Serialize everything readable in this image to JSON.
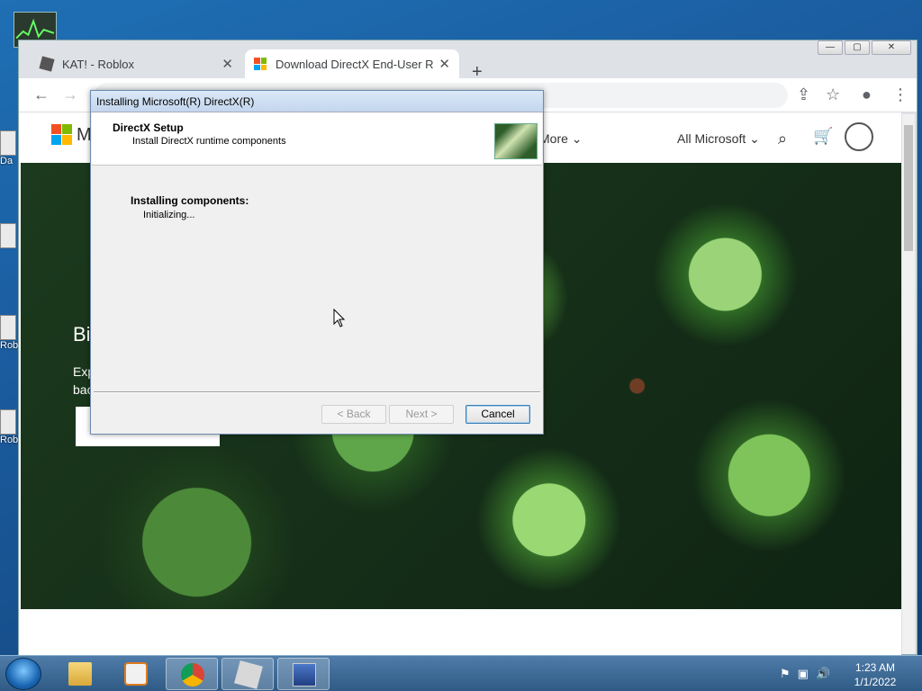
{
  "desktop": {
    "icons": [
      {
        "label": "Da",
        "icon": "document-icon"
      },
      {
        "label": "",
        "icon": "document-icon"
      },
      {
        "label": "Rob",
        "icon": "roblox-icon"
      },
      {
        "label": "Rob",
        "icon": "roblox-icon"
      }
    ]
  },
  "browser": {
    "tabs": [
      {
        "title": "KAT! - Roblox",
        "icon": "roblox-favicon",
        "active": false
      },
      {
        "title": "Download DirectX End-User Runtime",
        "icon": "microsoft-favicon",
        "active": true
      }
    ],
    "new_tab": "+",
    "close_glyph": "✕",
    "window_controls": {
      "minimize": "—",
      "maximize": "▢",
      "close": "✕"
    }
  },
  "page": {
    "brand_initial": "M",
    "more_label": "More",
    "all_microsoft_label": "All Microsoft",
    "hero_title": "Bi",
    "hero_text": "Exp bac"
  },
  "dialog": {
    "title": "Installing Microsoft(R) DirectX(R)",
    "heading": "DirectX Setup",
    "subheading": "Install DirectX runtime components",
    "status_heading": "Installing components:",
    "status_text": "Initializing...",
    "back_label": "< Back",
    "next_label": "Next >",
    "cancel_label": "Cancel"
  },
  "taskbar": {
    "apps": [
      {
        "name": "file-explorer",
        "active": false
      },
      {
        "name": "media-player",
        "active": false
      },
      {
        "name": "chrome",
        "active": true
      },
      {
        "name": "roblox",
        "active": true
      },
      {
        "name": "directx-setup",
        "active": true
      }
    ],
    "time": "1:23 AM",
    "date": "1/1/2022"
  },
  "colors": {
    "accent": "#1a66b2",
    "ms_red": "#f25022",
    "ms_green": "#7fba00",
    "ms_blue": "#00a4ef",
    "ms_yellow": "#ffb900"
  }
}
